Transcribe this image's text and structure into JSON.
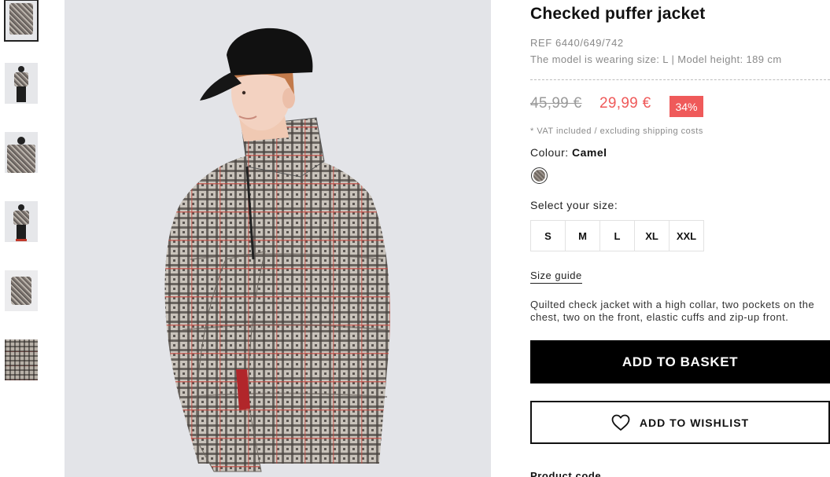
{
  "thumbnails": [
    {
      "id": "thumb-1",
      "kind": "jacket-front",
      "active": true
    },
    {
      "id": "thumb-2",
      "kind": "full-body-front"
    },
    {
      "id": "thumb-3",
      "kind": "upper-body"
    },
    {
      "id": "thumb-4",
      "kind": "full-body-front"
    },
    {
      "id": "thumb-5",
      "kind": "jacket-flat"
    },
    {
      "id": "thumb-6",
      "kind": "fabric-detail"
    }
  ],
  "product": {
    "title": "Checked puffer jacket",
    "ref": "REF 6440/649/742",
    "model_info": "The model is wearing size: L | Model height: 189 cm",
    "old_price": "45,99 €",
    "new_price": "29,99 €",
    "discount": "34%",
    "vat_note": "* VAT included / excluding shipping costs",
    "colour_label": "Colour:",
    "colour_value": "Camel",
    "select_size_label": "Select your size:",
    "sizes": [
      "S",
      "M",
      "L",
      "XL",
      "XXL"
    ],
    "size_guide": "Size guide",
    "description": "Quilted check jacket with a high collar, two pockets on the chest, two on the front, elastic cuffs and zip-up front.",
    "add_to_basket": "ADD TO BASKET",
    "add_to_wishlist": "ADD TO WISHLIST",
    "cut_text": "Product code"
  },
  "icons": {
    "heart": "heart-icon"
  },
  "colors": {
    "sale_red": "#ef5a5a",
    "button_black": "#000000",
    "muted_text": "#8a8a8a"
  }
}
